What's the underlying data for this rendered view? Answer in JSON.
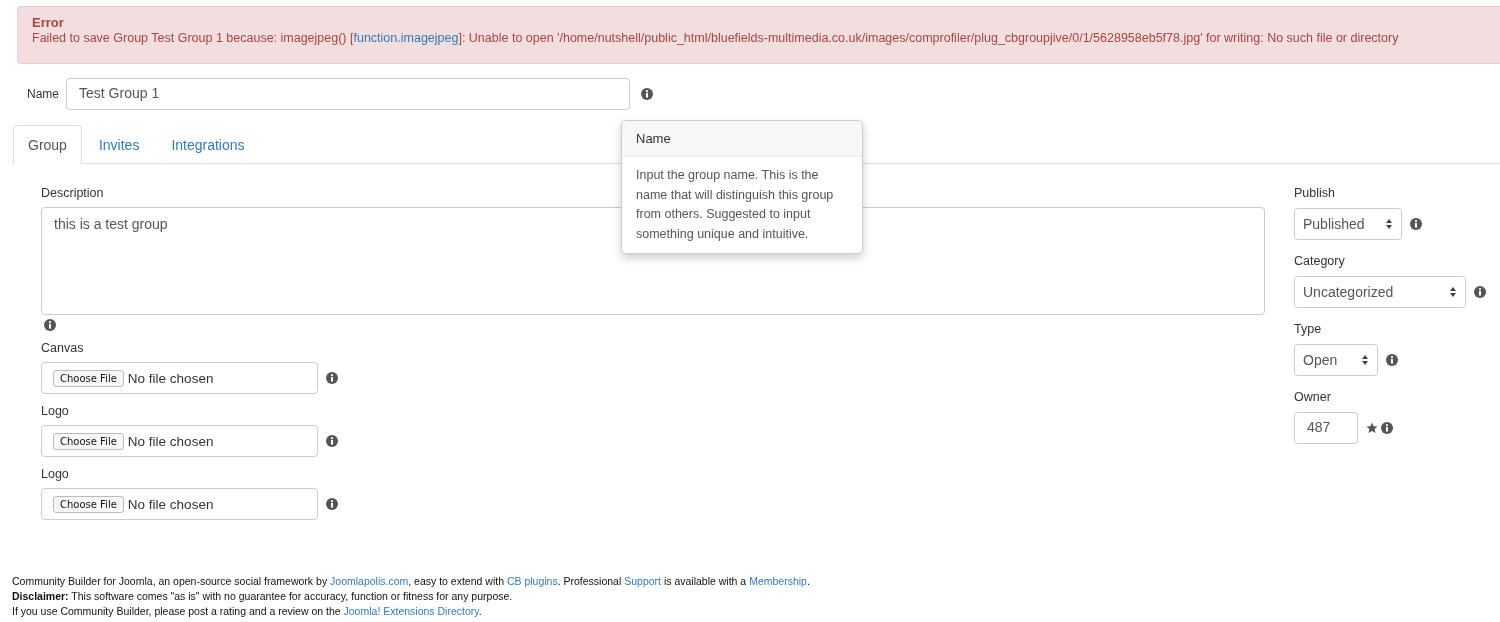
{
  "error": {
    "title": "Error",
    "message": [
      {
        "kind": "plain",
        "text": "Failed to save Group Test Group 1 because: imagejpeg() ["
      },
      {
        "kind": "link",
        "text": "function.imagejpeg"
      },
      {
        "kind": "plain",
        "text": "]: Unable to open '/home/nutshell/public_html/bluefields-multimedia.co.uk/images/comprofiler/plug_cbgroupjive/0/1/5628958eb5f78.jpg' for writing: No such file or directory"
      }
    ]
  },
  "name_field": {
    "label": "Name",
    "value": "Test Group 1"
  },
  "tooltip": {
    "title": "Name",
    "text": "Input the group name. This is the name that will distinguish this group from others. Suggested to input something unique and intuitive."
  },
  "tabs": [
    {
      "label": "Group",
      "selected": true
    },
    {
      "label": "Invites",
      "selected": false
    },
    {
      "label": "Integrations",
      "selected": false
    }
  ],
  "description": {
    "label": "Description",
    "value": "this is a test group"
  },
  "files": [
    {
      "label": "Canvas",
      "button": "Choose File",
      "status": "No file chosen"
    },
    {
      "label": "Logo",
      "button": "Choose File",
      "status": "No file chosen"
    },
    {
      "label": "Logo",
      "button": "Choose File",
      "status": "No file chosen"
    }
  ],
  "side_fields": [
    {
      "kind": "select",
      "label": "Publish",
      "value": "Published"
    },
    {
      "kind": "select",
      "label": "Category",
      "value": "Uncategorized"
    },
    {
      "kind": "select",
      "label": "Type",
      "value": "Open"
    },
    {
      "kind": "input",
      "label": "Owner",
      "value": "487"
    }
  ],
  "footer": [
    [
      {
        "kind": "plain",
        "text": "Community Builder for Joomla, an open-source social framework by "
      },
      {
        "kind": "link",
        "text": "Joomlapolis.com"
      },
      {
        "kind": "plain",
        "text": ", easy to extend with "
      },
      {
        "kind": "link",
        "text": "CB plugins"
      },
      {
        "kind": "plain",
        "text": ". Professional "
      },
      {
        "kind": "link",
        "text": "Support"
      },
      {
        "kind": "plain",
        "text": " is available with a "
      },
      {
        "kind": "link",
        "text": "Membership"
      },
      {
        "kind": "plain",
        "text": "."
      }
    ],
    [
      {
        "kind": "bold",
        "text": "Disclaimer:"
      },
      {
        "kind": "plain",
        "text": " This software comes \"as is\" with no guarantee for accuracy, function or fitness for any purpose."
      }
    ],
    [
      {
        "kind": "plain",
        "text": "If you use Community Builder, please post a rating and a review on the "
      },
      {
        "kind": "link",
        "text": "Joomla! Extensions Directory"
      },
      {
        "kind": "plain",
        "text": "."
      }
    ]
  ]
}
